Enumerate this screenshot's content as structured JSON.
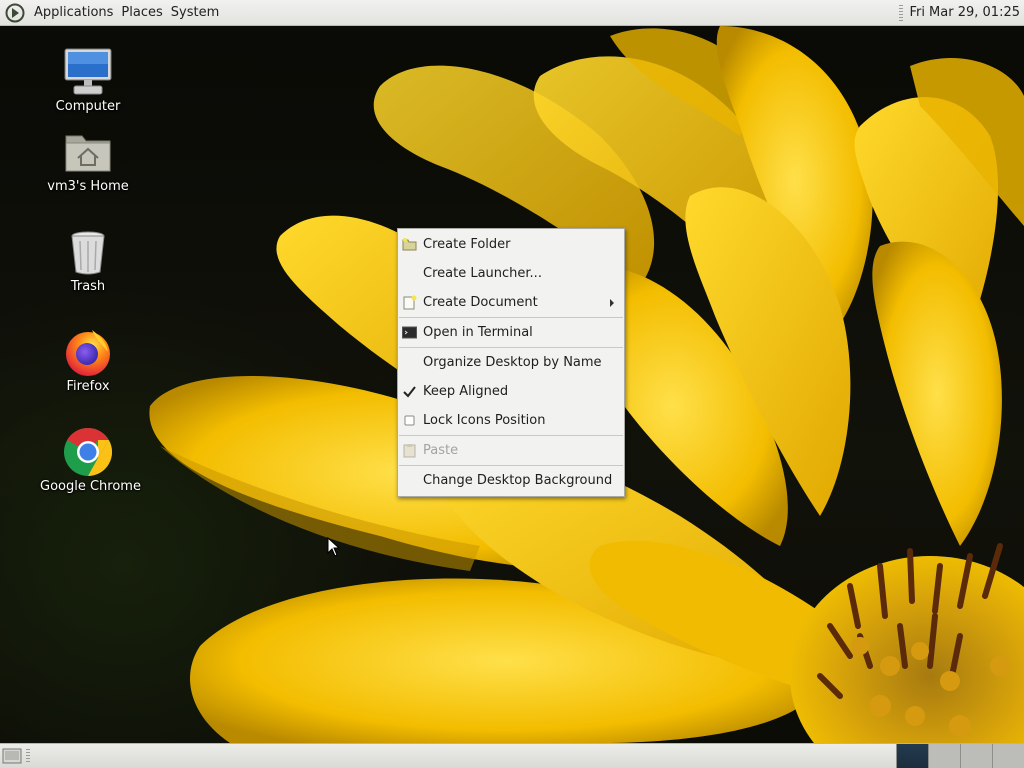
{
  "top_panel": {
    "menus": [
      "Applications",
      "Places",
      "System"
    ],
    "clock": "Fri Mar 29, 01:25"
  },
  "desktop_icons": [
    {
      "label": "Computer",
      "icon": "computer-icon"
    },
    {
      "label": "vm3's Home",
      "icon": "home-folder-icon"
    },
    {
      "label": "Trash",
      "icon": "trash-icon"
    },
    {
      "label": "Firefox",
      "icon": "firefox-icon"
    },
    {
      "label": "Google Chrome",
      "icon": "chrome-icon"
    }
  ],
  "context_menu": {
    "items": [
      {
        "label": "Create Folder",
        "icon": "folder-new-icon",
        "enabled": true
      },
      {
        "label": "Create Launcher...",
        "icon": "",
        "enabled": true
      },
      {
        "label": "Create Document",
        "icon": "document-new-icon",
        "enabled": true,
        "submenu": true
      },
      {
        "label": "Open in Terminal",
        "icon": "terminal-icon",
        "enabled": true
      },
      {
        "label": "Organize Desktop by Name",
        "icon": "",
        "enabled": true
      },
      {
        "label": "Keep Aligned",
        "icon": "checkmark-icon",
        "enabled": true,
        "checked": true
      },
      {
        "label": "Lock Icons Position",
        "icon": "checkbox-icon",
        "enabled": true,
        "checked": false
      },
      {
        "label": "Paste",
        "icon": "paste-icon",
        "enabled": false
      },
      {
        "label": "Change Desktop Background",
        "icon": "",
        "enabled": true
      }
    ]
  },
  "bottom_panel": {
    "workspaces": 4,
    "active_workspace": 1
  },
  "colors": {
    "panel": "#e6e6e3",
    "menu_bg": "#f2f2f0",
    "wallpaper_petal": "#f5c400",
    "workspace_active": "#1f3447"
  }
}
